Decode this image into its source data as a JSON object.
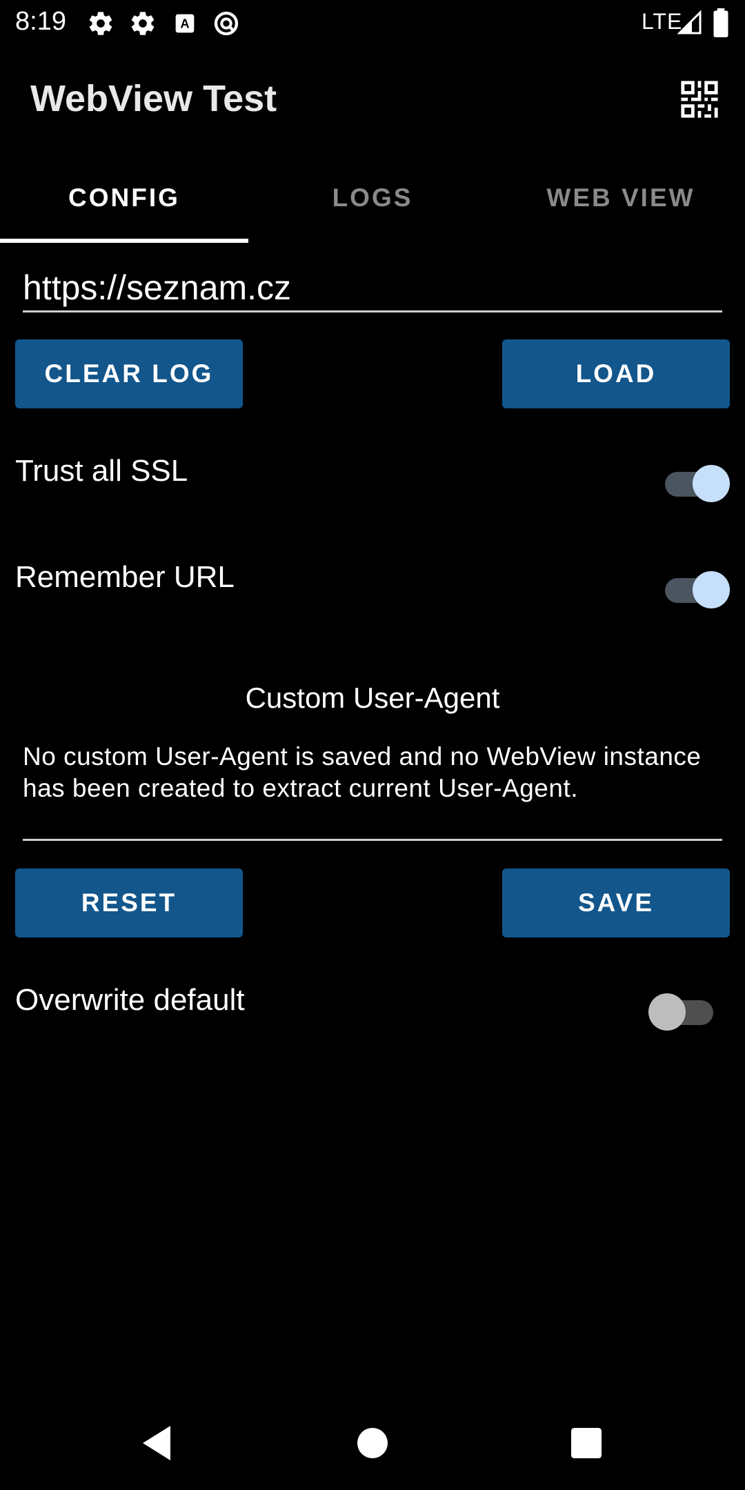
{
  "status_bar": {
    "time": "8:19",
    "network": "LTE",
    "icons": [
      "settings-icon",
      "settings-icon",
      "keyboard-a-icon",
      "vpn-icon",
      "signal-icon",
      "battery-icon"
    ]
  },
  "app_bar": {
    "title": "WebView Test",
    "action_icon": "qr-code-icon"
  },
  "tabs": [
    {
      "label": "CONFIG",
      "active": true
    },
    {
      "label": "LOGS",
      "active": false
    },
    {
      "label": "WEB VIEW",
      "active": false
    }
  ],
  "url_field": {
    "value": "https://seznam.cz"
  },
  "buttons": {
    "clear_log": "CLEAR LOG",
    "load": "LOAD",
    "reset": "RESET",
    "save": "SAVE"
  },
  "settings": {
    "trust_ssl": {
      "label": "Trust all SSL",
      "on": true
    },
    "remember_url": {
      "label": "Remember URL",
      "on": true
    },
    "overwrite_default": {
      "label": "Overwrite default",
      "on": false
    }
  },
  "user_agent": {
    "heading": "Custom User-Agent",
    "text": "No custom User-Agent is saved and no WebView instance has been created to extract current User-Agent."
  },
  "colors": {
    "background": "#000000",
    "button": "#12568c",
    "switch_thumb_on": "#c6e0fb",
    "inactive_tab": "#8a8a8a"
  },
  "nav_bar": {
    "icons": [
      "back-icon",
      "home-icon",
      "recents-icon"
    ]
  }
}
